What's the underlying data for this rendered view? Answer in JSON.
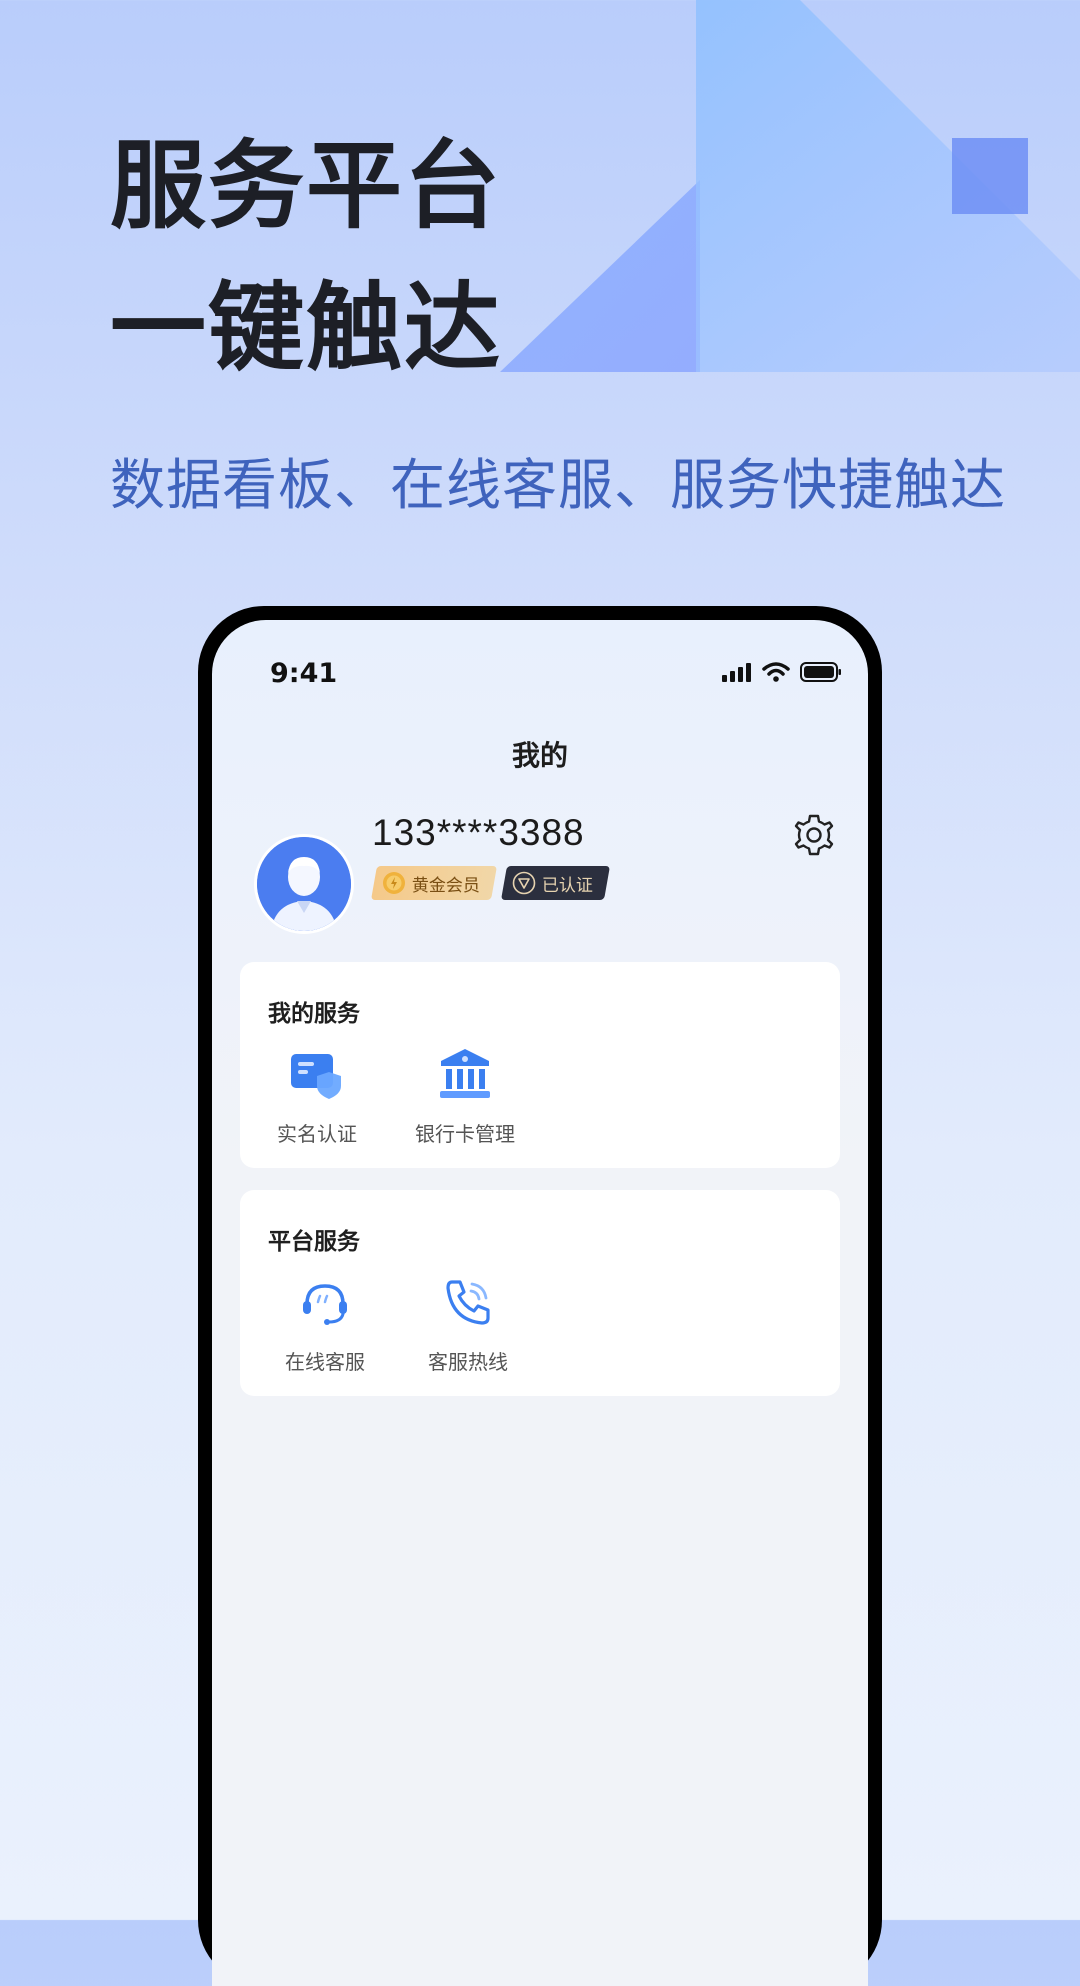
{
  "promo": {
    "headline_line1": "服务平台",
    "headline_line2": "一键触达",
    "subtitle": "数据看板、在线客服、服务快捷触达"
  },
  "status_bar": {
    "time": "9:41"
  },
  "page": {
    "title": "我的"
  },
  "profile": {
    "phone": "133****3388",
    "badges": {
      "member": "黄金会员",
      "verified": "已认证"
    }
  },
  "my_services": {
    "title": "我的服务",
    "items": [
      {
        "label": "实名认证",
        "icon": "id-card-shield-icon"
      },
      {
        "label": "银行卡管理",
        "icon": "bank-icon"
      }
    ]
  },
  "platform_services": {
    "title": "平台服务",
    "items": [
      {
        "label": "在线客服",
        "icon": "headset-chat-icon"
      },
      {
        "label": "客服热线",
        "icon": "phone-call-icon"
      }
    ]
  },
  "colors": {
    "accent": "#3f63bd",
    "icon_blue": "#3b7ff0",
    "badge_gold": "#f5c989",
    "badge_dark": "#2b2f3e"
  }
}
